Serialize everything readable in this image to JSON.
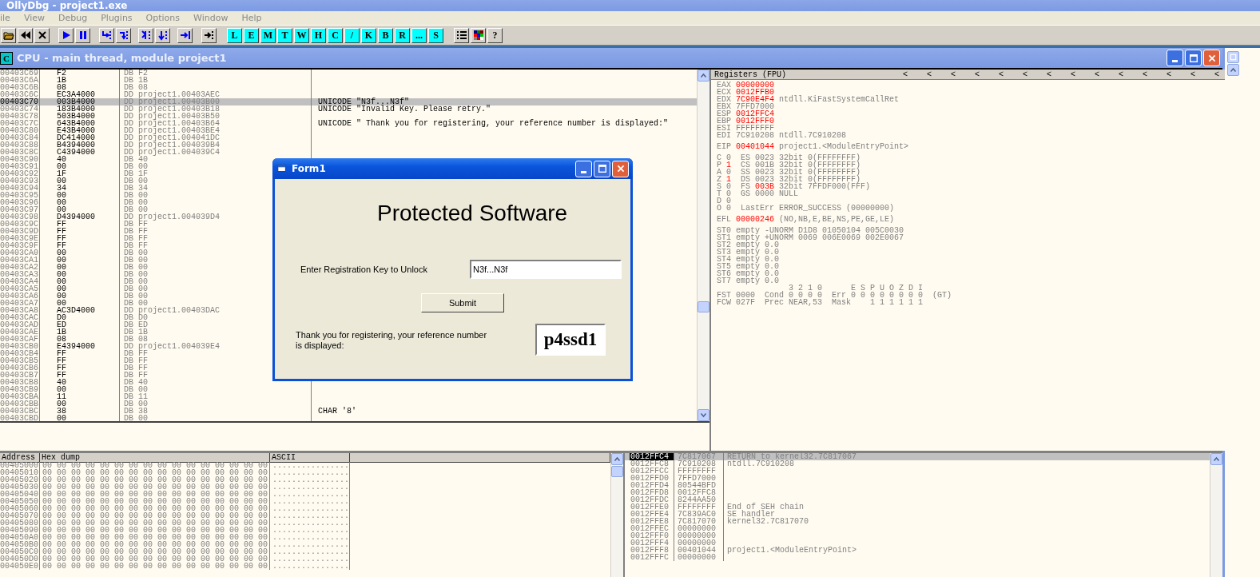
{
  "app": {
    "title": "OllyDbg - project1.exe"
  },
  "menu": [
    "ile",
    "View",
    "Debug",
    "Plugins",
    "Options",
    "Window",
    "Help"
  ],
  "toolbar": {
    "letter_buttons": [
      "L",
      "E",
      "M",
      "T",
      "W",
      "H",
      "C",
      "/",
      "K",
      "B",
      "R",
      "...",
      "S"
    ],
    "help_button": "?"
  },
  "cpu_window": {
    "icon_text": "C",
    "title": "CPU - main thread, module project1"
  },
  "disassembly": {
    "rows": [
      {
        "address": "00403C69",
        "hex": "F2",
        "disasm": "DB F2",
        "selected": false
      },
      {
        "address": "00403C6A",
        "hex": "1B",
        "disasm": "DB 1B",
        "selected": false
      },
      {
        "address": "00403C6B",
        "hex": "08",
        "disasm": "DB 08",
        "selected": false
      },
      {
        "address": "00403C6C",
        "hex": "EC3A4000",
        "disasm": "DD project1.00403AEC",
        "selected": false
      },
      {
        "address": "00403C70",
        "hex": "003B4000",
        "disasm": "DD project1.00403B00",
        "comment": "UNICODE \"N3f...N3f\"",
        "selected": true
      },
      {
        "address": "00403C74",
        "hex": "183B4000",
        "disasm": "DD project1.00403B18",
        "comment": "UNICODE \"Invalid Key. Please retry.\"",
        "selected": false
      },
      {
        "address": "00403C78",
        "hex": "503B4000",
        "disasm": "DD project1.00403B50",
        "selected": false
      },
      {
        "address": "00403C7C",
        "hex": "643B4000",
        "disasm": "DD project1.00403B64",
        "comment": "UNICODE \" Thank you for registering, your reference number is displayed:\"",
        "selected": false
      },
      {
        "address": "00403C80",
        "hex": "E43B4000",
        "disasm": "DD project1.00403BE4",
        "selected": false
      },
      {
        "address": "00403C84",
        "hex": "DC414000",
        "disasm": "DD project1.004041DC",
        "selected": false
      },
      {
        "address": "00403C88",
        "hex": "B4394000",
        "disasm": "DD project1.004039B4",
        "selected": false
      },
      {
        "address": "00403C8C",
        "hex": "C4394000",
        "disasm": "DD project1.004039C4",
        "selected": false
      },
      {
        "address": "00403C90",
        "hex": "40",
        "disasm": "DB 40",
        "selected": false
      },
      {
        "address": "00403C91",
        "hex": "00",
        "disasm": "DB 00",
        "selected": false
      },
      {
        "address": "00403C92",
        "hex": "1F",
        "disasm": "DB 1F",
        "selected": false
      },
      {
        "address": "00403C93",
        "hex": "00",
        "disasm": "DB 00",
        "selected": false
      },
      {
        "address": "00403C94",
        "hex": "34",
        "disasm": "DB 34",
        "selected": false
      },
      {
        "address": "00403C95",
        "hex": "00",
        "disasm": "DB 00",
        "selected": false
      },
      {
        "address": "00403C96",
        "hex": "00",
        "disasm": "DB 00",
        "selected": false
      },
      {
        "address": "00403C97",
        "hex": "00",
        "disasm": "DB 00",
        "selected": false
      },
      {
        "address": "00403C98",
        "hex": "D4394000",
        "disasm": "DD project1.004039D4",
        "selected": false
      },
      {
        "address": "00403C9C",
        "hex": "FF",
        "disasm": "DB FF",
        "selected": false
      },
      {
        "address": "00403C9D",
        "hex": "FF",
        "disasm": "DB FF",
        "selected": false
      },
      {
        "address": "00403C9E",
        "hex": "FF",
        "disasm": "DB FF",
        "selected": false
      },
      {
        "address": "00403C9F",
        "hex": "FF",
        "disasm": "DB FF",
        "selected": false
      },
      {
        "address": "00403CA0",
        "hex": "00",
        "disasm": "DB 00",
        "selected": false
      },
      {
        "address": "00403CA1",
        "hex": "00",
        "disasm": "DB 00",
        "selected": false
      },
      {
        "address": "00403CA2",
        "hex": "00",
        "disasm": "DB 00",
        "selected": false
      },
      {
        "address": "00403CA3",
        "hex": "00",
        "disasm": "DB 00",
        "selected": false
      },
      {
        "address": "00403CA4",
        "hex": "00",
        "disasm": "DB 00",
        "selected": false
      },
      {
        "address": "00403CA5",
        "hex": "00",
        "disasm": "DB 00",
        "selected": false
      },
      {
        "address": "00403CA6",
        "hex": "00",
        "disasm": "DB 00",
        "selected": false
      },
      {
        "address": "00403CA7",
        "hex": "00",
        "disasm": "DB 00",
        "selected": false
      },
      {
        "address": "00403CA8",
        "hex": "AC3D4000",
        "disasm": "DD project1.00403DAC",
        "selected": false
      },
      {
        "address": "00403CAC",
        "hex": "D0",
        "disasm": "DB D0",
        "selected": false
      },
      {
        "address": "00403CAD",
        "hex": "ED",
        "disasm": "DB ED",
        "selected": false
      },
      {
        "address": "00403CAE",
        "hex": "1B",
        "disasm": "DB 1B",
        "selected": false
      },
      {
        "address": "00403CAF",
        "hex": "08",
        "disasm": "DB 08",
        "selected": false
      },
      {
        "address": "00403CB0",
        "hex": "E4394000",
        "disasm": "DD project1.004039E4",
        "selected": false
      },
      {
        "address": "00403CB4",
        "hex": "FF",
        "disasm": "DB FF",
        "selected": false
      },
      {
        "address": "00403CB5",
        "hex": "FF",
        "disasm": "DB FF",
        "selected": false
      },
      {
        "address": "00403CB6",
        "hex": "FF",
        "disasm": "DB FF",
        "selected": false
      },
      {
        "address": "00403CB7",
        "hex": "FF",
        "disasm": "DB FF",
        "selected": false
      },
      {
        "address": "00403CB8",
        "hex": "40",
        "disasm": "DB 40",
        "selected": false
      },
      {
        "address": "00403CB9",
        "hex": "00",
        "disasm": "DB 00",
        "selected": false
      },
      {
        "address": "00403CBA",
        "hex": "11",
        "disasm": "DB 11",
        "selected": false
      },
      {
        "address": "00403CBB",
        "hex": "00",
        "disasm": "DB 00",
        "selected": false
      },
      {
        "address": "00403CBC",
        "hex": "38",
        "disasm": "DB 38",
        "comment": "CHAR '8'",
        "selected": false
      },
      {
        "address": "00403CBD",
        "hex": "00",
        "disasm": "DB 00",
        "selected": false
      }
    ]
  },
  "registers": {
    "title": "Registers (FPU)",
    "arrows": [
      "<",
      "<",
      "<",
      "<",
      "<",
      "<",
      "<",
      "<",
      "<",
      "<",
      "<",
      "<",
      "<",
      "<"
    ],
    "groups": [
      [
        [
          {
            "text": "EAX ",
            "changed": false
          },
          {
            "text": "00000000",
            "changed": true
          }
        ],
        [
          {
            "text": "ECX ",
            "changed": false
          },
          {
            "text": "0012FFB0",
            "changed": true
          }
        ],
        [
          {
            "text": "EDX ",
            "changed": false
          },
          {
            "text": "7C90E4F4",
            "changed": true
          },
          {
            "text": " ntdll.KiFastSystemCallRet",
            "changed": false
          }
        ],
        [
          {
            "text": "EBX 7FFD7000",
            "changed": false
          }
        ],
        [
          {
            "text": "ESP ",
            "changed": false
          },
          {
            "text": "0012FFC4",
            "changed": true
          }
        ],
        [
          {
            "text": "EBP ",
            "changed": false
          },
          {
            "text": "0012FFF0",
            "changed": true
          }
        ],
        [
          {
            "text": "ESI FFFFFFFF",
            "changed": false
          }
        ],
        [
          {
            "text": "EDI 7C910208 ntdll.7C910208",
            "changed": false
          }
        ]
      ],
      [
        [
          {
            "text": "EIP ",
            "changed": false
          },
          {
            "text": "00401044",
            "changed": true
          },
          {
            "text": " project1.<ModuleEntryPoint>",
            "changed": false
          }
        ]
      ],
      [
        [
          {
            "text": "C 0  ES 0023 32bit 0(FFFFFFFF)",
            "changed": false
          }
        ],
        [
          {
            "text": "P ",
            "changed": false
          },
          {
            "text": "1",
            "changed": true
          },
          {
            "text": "  CS 001B 32bit 0(FFFFFFFF)",
            "changed": false
          }
        ],
        [
          {
            "text": "A 0  SS 0023 32bit 0(FFFFFFFF)",
            "changed": false
          }
        ],
        [
          {
            "text": "Z ",
            "changed": false
          },
          {
            "text": "1",
            "changed": true
          },
          {
            "text": "  DS 0023 32bit 0(FFFFFFFF)",
            "changed": false
          }
        ],
        [
          {
            "text": "S 0  FS ",
            "changed": false
          },
          {
            "text": "003B",
            "changed": true
          },
          {
            "text": " 32bit 7FFDF000(FFF)",
            "changed": false
          }
        ],
        [
          {
            "text": "T 0  GS 0000 NULL",
            "changed": false
          }
        ],
        [
          {
            "text": "D 0",
            "changed": false
          }
        ],
        [
          {
            "text": "O 0  LastErr ERROR_SUCCESS (00000000)",
            "changed": false
          }
        ]
      ],
      [
        [
          {
            "text": "EFL ",
            "changed": false
          },
          {
            "text": "00000246",
            "changed": true
          },
          {
            "text": " (NO,NB,E,BE,NS,PE,GE,LE)",
            "changed": false
          }
        ]
      ],
      [
        [
          {
            "text": "ST0 empty -UNORM D1D8 01050104 005C0030",
            "changed": false
          }
        ],
        [
          {
            "text": "ST1 empty +UNORM 0069 006E0069 002E0067",
            "changed": false
          }
        ],
        [
          {
            "text": "ST2 empty 0.0",
            "changed": false
          }
        ],
        [
          {
            "text": "ST3 empty 0.0",
            "changed": false
          }
        ],
        [
          {
            "text": "ST4 empty 0.0",
            "changed": false
          }
        ],
        [
          {
            "text": "ST5 empty 0.0",
            "changed": false
          }
        ],
        [
          {
            "text": "ST6 empty 0.0",
            "changed": false
          }
        ],
        [
          {
            "text": "ST7 empty 0.0",
            "changed": false
          }
        ],
        [
          {
            "text": "               3 2 1 0      E S P U O Z D I",
            "changed": false
          }
        ],
        [
          {
            "text": "FST 0000  Cond 0 0 0 0  Err 0 0 0 0 0 0 0 0  (GT)",
            "changed": false
          }
        ],
        [
          {
            "text": "FCW 027F  Prec NEAR,53  Mask    1 1 1 1 1 1",
            "changed": false
          }
        ]
      ]
    ]
  },
  "dump": {
    "columns": [
      "Address",
      "Hex dump",
      "ASCII"
    ],
    "rows": [
      {
        "address": "00405000",
        "hex": "00 00 00 00 00 00 00 00 00 00 00 00 00 00 00 00",
        "ascii": "................"
      },
      {
        "address": "00405010",
        "hex": "00 00 00 00 00 00 00 00 00 00 00 00 00 00 00 00",
        "ascii": "................"
      },
      {
        "address": "00405020",
        "hex": "00 00 00 00 00 00 00 00 00 00 00 00 00 00 00 00",
        "ascii": "................"
      },
      {
        "address": "00405030",
        "hex": "00 00 00 00 00 00 00 00 00 00 00 00 00 00 00 00",
        "ascii": "................"
      },
      {
        "address": "00405040",
        "hex": "00 00 00 00 00 00 00 00 00 00 00 00 00 00 00 00",
        "ascii": "................"
      },
      {
        "address": "00405050",
        "hex": "00 00 00 00 00 00 00 00 00 00 00 00 00 00 00 00",
        "ascii": "................"
      },
      {
        "address": "00405060",
        "hex": "00 00 00 00 00 00 00 00 00 00 00 00 00 00 00 00",
        "ascii": "................"
      },
      {
        "address": "00405070",
        "hex": "00 00 00 00 00 00 00 00 00 00 00 00 00 00 00 00",
        "ascii": "................"
      },
      {
        "address": "00405080",
        "hex": "00 00 00 00 00 00 00 00 00 00 00 00 00 00 00 00",
        "ascii": "................"
      },
      {
        "address": "00405090",
        "hex": "00 00 00 00 00 00 00 00 00 00 00 00 00 00 00 00",
        "ascii": "................"
      },
      {
        "address": "004050A0",
        "hex": "00 00 00 00 00 00 00 00 00 00 00 00 00 00 00 00",
        "ascii": "................"
      },
      {
        "address": "004050B0",
        "hex": "00 00 00 00 00 00 00 00 00 00 00 00 00 00 00 00",
        "ascii": "................"
      },
      {
        "address": "004050C0",
        "hex": "00 00 00 00 00 00 00 00 00 00 00 00 00 00 00 00",
        "ascii": "................"
      },
      {
        "address": "004050D0",
        "hex": "00 00 00 00 00 00 00 00 00 00 00 00 00 00 00 00",
        "ascii": "................"
      },
      {
        "address": "004050E0",
        "hex": "00 00 00 00 00 00 00 00 00 00 00 00 00 00 00 00",
        "ascii": "................"
      }
    ]
  },
  "stack": {
    "rows": [
      {
        "address": "0012FFC4",
        "value": "7C817067",
        "comment": "RETURN to kernel32.7C817067",
        "selected": true
      },
      {
        "address": "0012FFC8",
        "value": "7C910208",
        "comment": "ntdll.7C910208",
        "selected": false
      },
      {
        "address": "0012FFCC",
        "value": "FFFFFFFF",
        "selected": false
      },
      {
        "address": "0012FFD0",
        "value": "7FFD7000",
        "selected": false
      },
      {
        "address": "0012FFD4",
        "value": "80544BFD",
        "selected": false
      },
      {
        "address": "0012FFD8",
        "value": "0012FFC8",
        "selected": false
      },
      {
        "address": "0012FFDC",
        "value": "8244AA50",
        "selected": false
      },
      {
        "address": "0012FFE0",
        "value": "FFFFFFFF",
        "comment": "End of SEH chain",
        "selected": false
      },
      {
        "address": "0012FFE4",
        "value": "7C839AC0",
        "comment": "SE handler",
        "selected": false
      },
      {
        "address": "0012FFE8",
        "value": "7C817070",
        "comment": "kernel32.7C817070",
        "selected": false
      },
      {
        "address": "0012FFEC",
        "value": "00000000",
        "selected": false
      },
      {
        "address": "0012FFF0",
        "value": "00000000",
        "selected": false
      },
      {
        "address": "0012FFF4",
        "value": "00000000",
        "selected": false
      },
      {
        "address": "0012FFF8",
        "value": "00401044",
        "comment": "project1.<ModuleEntryPoint>",
        "selected": false
      },
      {
        "address": "0012FFFC",
        "value": "00000000",
        "selected": false
      }
    ]
  },
  "dialog": {
    "title": "Form1",
    "heading": "Protected Software",
    "key_label": "Enter Registration Key to Unlock",
    "key_value": "N3f...N3f",
    "submit": "Submit",
    "result_label": "Thank you for registering, your reference number is displayed:",
    "result_value": "p4ssd1"
  }
}
